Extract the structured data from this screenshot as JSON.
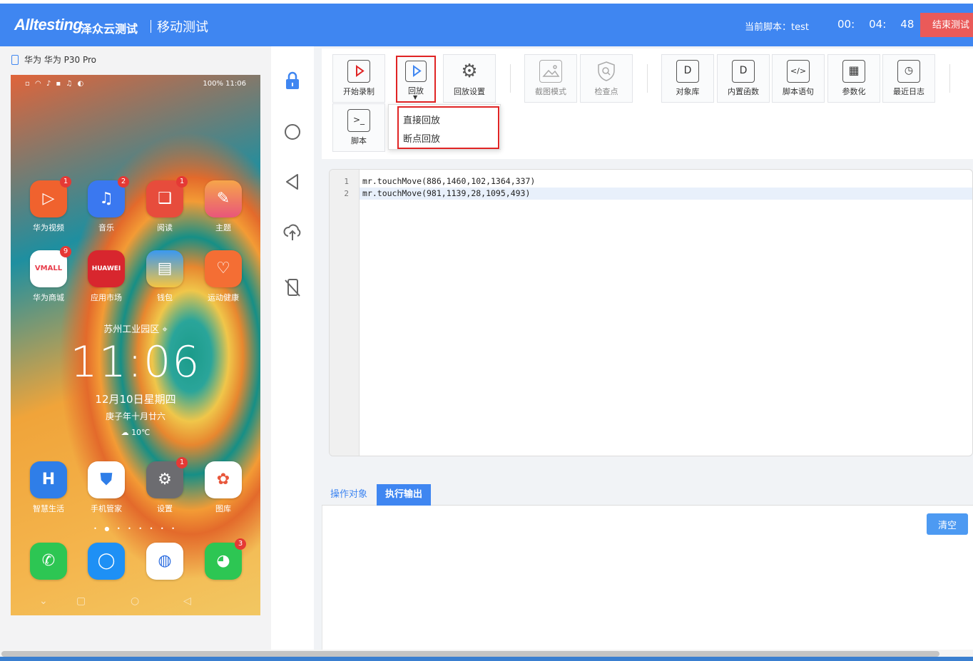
{
  "header": {
    "brand": "Alltesting",
    "brand_cn": "泽众云测试",
    "module": "移动测试",
    "current_script": "当前脚本：test",
    "timer": {
      "h": "00:",
      "m": "04:",
      "s": "48"
    },
    "end_label": "结束测试"
  },
  "device": {
    "name": "华为 华为 P30 Pro",
    "status_right": "100%  11:06",
    "apps": [
      {
        "label": "华为视频",
        "badge": "1",
        "color": "#f0622e"
      },
      {
        "label": "音乐",
        "badge": "2",
        "color": "#3a78f0"
      },
      {
        "label": "阅读",
        "badge": "1",
        "color": "#e74c3c"
      },
      {
        "label": "主题",
        "badge": "",
        "color": "#f08a3a"
      },
      {
        "label": "华为商城",
        "badge": "9",
        "color": "#e83e4c"
      },
      {
        "label": "应用市场",
        "badge": "",
        "color": "#d8262e"
      },
      {
        "label": "钱包",
        "badge": "",
        "color": "#3a98f0"
      },
      {
        "label": "运动健康",
        "badge": "",
        "color": "#f46e34"
      },
      {
        "label": "智慧生活",
        "badge": "",
        "color": "#2f7ee8"
      },
      {
        "label": "手机管家",
        "badge": "",
        "color": "#ffffff"
      },
      {
        "label": "设置",
        "badge": "1",
        "color": "#6c6c70"
      },
      {
        "label": "图库",
        "badge": "",
        "color": "#ffffff"
      }
    ],
    "dock": [
      {
        "badge": "",
        "color": "#2dc653"
      },
      {
        "badge": "",
        "color": "#1e90f5"
      },
      {
        "badge": "",
        "color": "#2f6fe0"
      },
      {
        "badge": "3",
        "color": "#2dc653"
      }
    ],
    "location": "苏州工业园区",
    "clock": "11:06",
    "date": "12月10日星期四",
    "lunar": "庚子年十月廿六",
    "weather": "10℃"
  },
  "toolbar": {
    "start_record": "开始录制",
    "playback": "回放",
    "playback_settings": "回放设置",
    "screenshot_mode": "截图模式",
    "checkpoint": "检查点",
    "object_lib": "对象库",
    "builtin_func": "内置函数",
    "script_statement": "脚本语句",
    "parameterize": "参数化",
    "recent_log": "最近日志",
    "script": "脚本"
  },
  "playback_menu": {
    "direct": "直接回放",
    "breakpoint": "断点回放"
  },
  "editor": {
    "lines": [
      "mr.touchMove(886,1460,102,1364,337)",
      "mr.touchMove(981,1139,28,1095,493)"
    ]
  },
  "tabs": {
    "objects": "操作对象",
    "output": "执行输出"
  },
  "clear_label": "清空",
  "colors": {
    "primary": "#3f86f1",
    "danger": "#ea5a59",
    "highlight": "#e02424"
  }
}
